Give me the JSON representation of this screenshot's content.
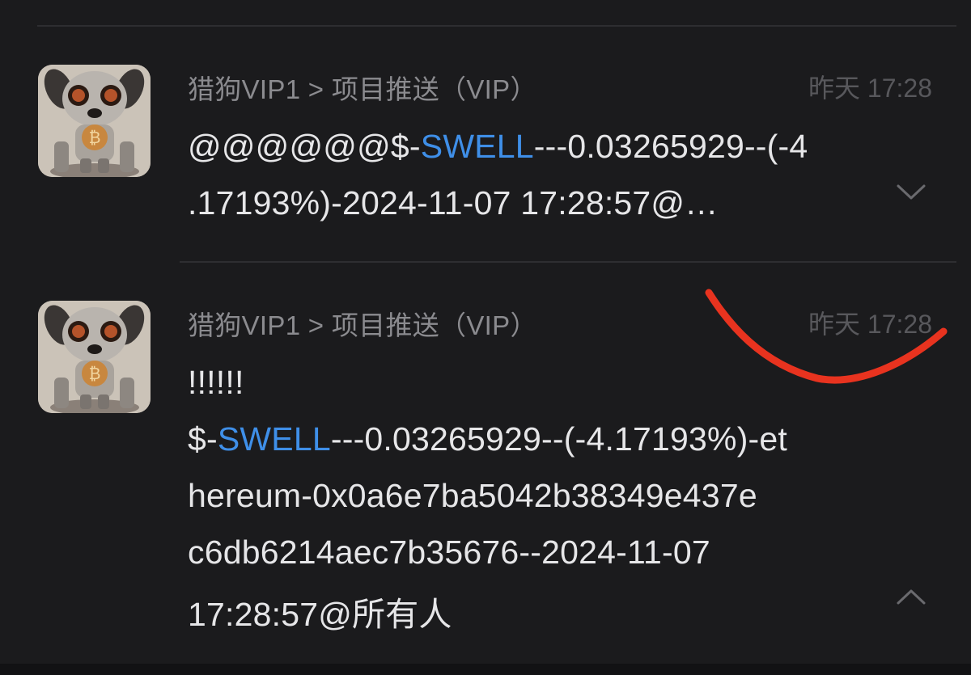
{
  "messages": [
    {
      "sender": "猎狗VIP1 > 项目推送（VIP）",
      "time": "昨天 17:28",
      "line1_prefix": "@@@@@@$-",
      "line1_tag": "SWELL",
      "line1_suffix": "---0.03265929--(-4",
      "line2": ".17193%)-2024-11-07 17:28:57@…",
      "toggle_icon": "chevron-down-icon"
    },
    {
      "sender": "猎狗VIP1 > 项目推送（VIP）",
      "time": "昨天 17:28",
      "line1": "!!!!!!",
      "line2_prefix": "$-",
      "line2_tag": "SWELL",
      "line2_suffix": "---0.03265929--(-4.17193%)-et",
      "line3": "hereum-0x0a6e7ba5042b38349e437e",
      "line4": "c6db6214aec7b35676--2024-11-07",
      "line5": "17:28:57@所有人",
      "toggle_icon": "chevron-up-icon"
    }
  ],
  "colors": {
    "background": "#1b1b1d",
    "text": "#e6e6e8",
    "sender": "#8b8b8f",
    "time": "#58585c",
    "tag": "#3f8fe8",
    "annotation": "#e8331f"
  }
}
